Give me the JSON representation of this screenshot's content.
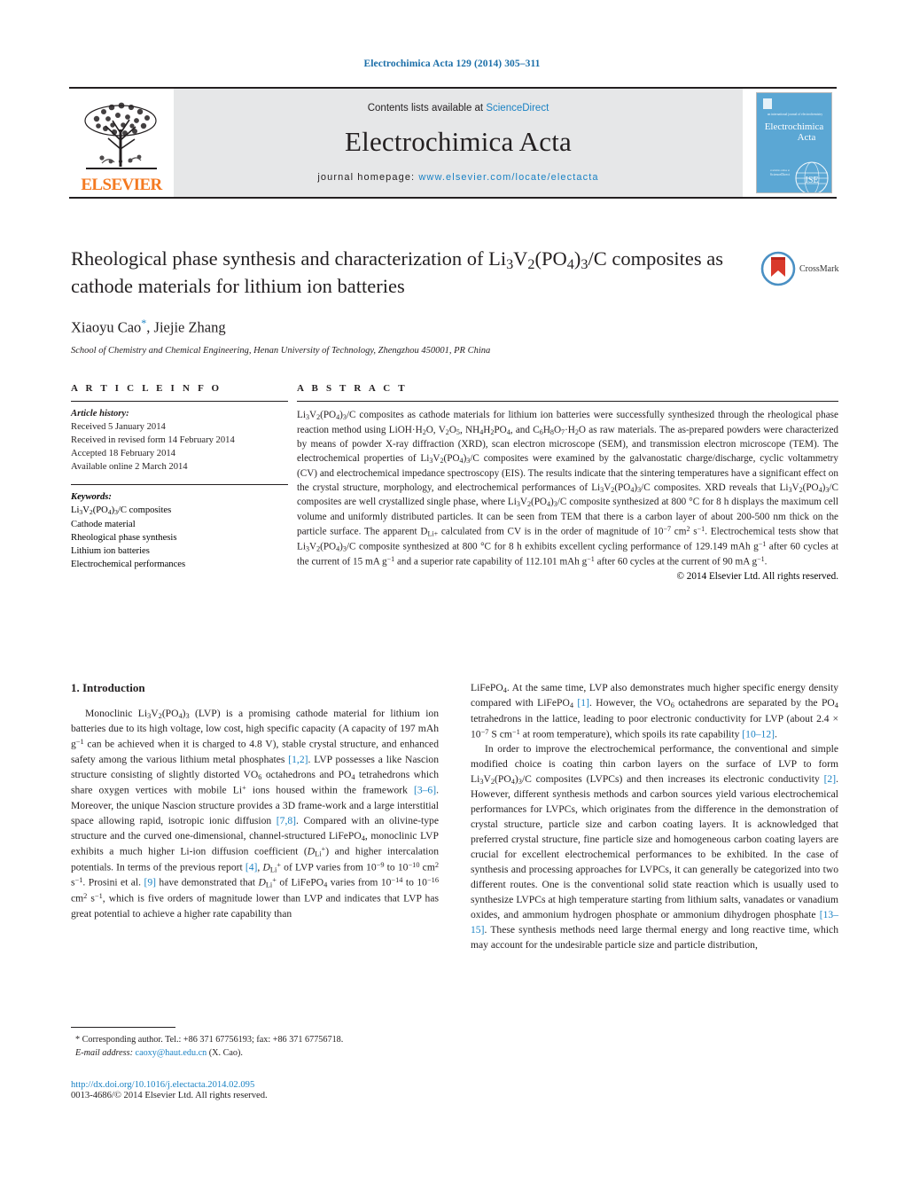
{
  "running_head": "Electrochimica Acta 129 (2014) 305–311",
  "masthead": {
    "publisher_name": "ELSEVIER",
    "contents_prefix": "Contents lists available at ",
    "contents_link": "ScienceDirect",
    "journal_title": "Electrochimica Acta",
    "homepage_prefix": "journal homepage:",
    "homepage_url": "www.elsevier.com/locate/electacta",
    "cover_line1": "Electrochimica",
    "cover_line2": "Acta",
    "cover_caption": "Official Journal of the International Society of Electrochemistry"
  },
  "article": {
    "title_line1_a": "Rheological phase synthesis and characterization of Li",
    "title_formula": "Li3V2(PO4)3/C",
    "title_full": "Rheological phase synthesis and characterization of Li3V2(PO4)3/C composites as cathode materials for lithium ion batteries",
    "title_tail": "composites as cathode materials for lithium ion batteries",
    "authors": "Xiaoyu Cao, Jiejie Zhang",
    "author1": "Xiaoyu Cao",
    "author2": "Jiejie Zhang",
    "affiliation": "School of Chemistry and Chemical Engineering, Henan University of Technology, Zhengzhou 450001, PR China",
    "crossmark_label": "CrossMark"
  },
  "article_info": {
    "heading": "A R T I C L E    I N F O",
    "history_label": "Article history:",
    "history": [
      "Received 5 January 2014",
      "Received in revised form 14 February 2014",
      "Accepted 18 February 2014",
      "Available online 2 March 2014"
    ],
    "keywords_label": "Keywords:",
    "keywords": [
      "Li3V2(PO4)3/C composites",
      "Cathode material",
      "Rheological phase synthesis",
      "Lithium ion batteries",
      "Electrochemical performances"
    ]
  },
  "abstract": {
    "heading": "A B S T R A C T",
    "copyright": "© 2014 Elsevier Ltd. All rights reserved."
  },
  "introduction": {
    "heading": "1.  Introduction"
  },
  "footnote": {
    "corresponding": "* Corresponding author. Tel.: +86 371 67756193; fax: +86 371 67756718.",
    "email_label": "E-mail address:",
    "email": "caoxy@haut.edu.cn",
    "email_owner": "(X. Cao)."
  },
  "doi_block": {
    "doi": "http://dx.doi.org/10.1016/j.electacta.2014.02.095",
    "issn": "0013-4686/© 2014 Elsevier Ltd. All rights reserved."
  },
  "colors": {
    "link": "#1a82c4",
    "running_head": "#1a6ea8",
    "elsevier_orange": "#f47920",
    "band_gray": "#e6e7e8",
    "cover_blue": "#5ba7d4"
  }
}
